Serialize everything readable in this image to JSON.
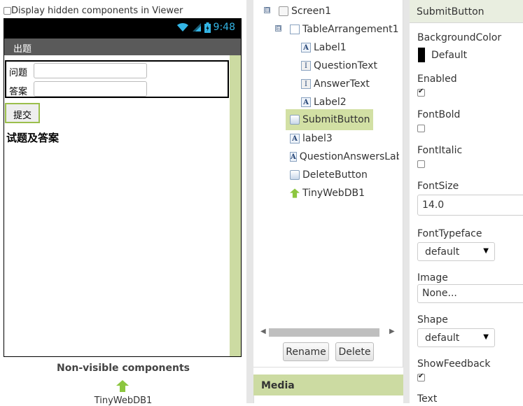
{
  "viewer": {
    "hidden_components_label": "Display hidden components in Viewer",
    "status_time": "9:48",
    "screen_title": "出题",
    "question_label": "问题",
    "answer_label": "答案",
    "submit_label": "提交",
    "qa_label": "试题及答案",
    "nonvisible_title": "Non-visible components",
    "nonvisible_items": [
      "TinyWebDB1"
    ]
  },
  "tree": {
    "items": [
      {
        "label": "Screen1",
        "icon": "screen-icon"
      },
      {
        "label": "TableArrangement1",
        "icon": "table-arrangement-icon"
      },
      {
        "label": "Label1",
        "icon": "label-icon"
      },
      {
        "label": "QuestionText",
        "icon": "textbox-icon"
      },
      {
        "label": "AnswerText",
        "icon": "textbox-icon"
      },
      {
        "label": "Label2",
        "icon": "label-icon"
      },
      {
        "label": "SubmitButton",
        "icon": "button-icon",
        "selected": true
      },
      {
        "label": "label3",
        "icon": "label-icon"
      },
      {
        "label": "QuestionAnswersLabe",
        "icon": "label-icon"
      },
      {
        "label": "DeleteButton",
        "icon": "button-icon"
      },
      {
        "label": "TinyWebDB1",
        "icon": "tinywebdb-icon"
      }
    ],
    "toggle_symbol": "⊟",
    "rename_label": "Rename",
    "delete_label": "Delete",
    "media_title": "Media"
  },
  "properties": {
    "component_name": "SubmitButton",
    "background_color_label": "BackgroundColor",
    "background_color_value": "Default",
    "background_color": "#000000",
    "enabled_label": "Enabled",
    "enabled": true,
    "fontbold_label": "FontBold",
    "fontbold": false,
    "fontitalic_label": "FontItalic",
    "fontitalic": false,
    "fontsize_label": "FontSize",
    "fontsize_value": "14.0",
    "fonttypeface_label": "FontTypeface",
    "fonttypeface_value": "default",
    "image_label": "Image",
    "image_value": "None...",
    "shape_label": "Shape",
    "shape_value": "default",
    "showfeedback_label": "ShowFeedback",
    "showfeedback": true,
    "text_label": "Text"
  },
  "colors": {
    "accent_green": "#ccdba2",
    "selection": "#d2e0a4",
    "status_icons": "#33b5e5"
  }
}
